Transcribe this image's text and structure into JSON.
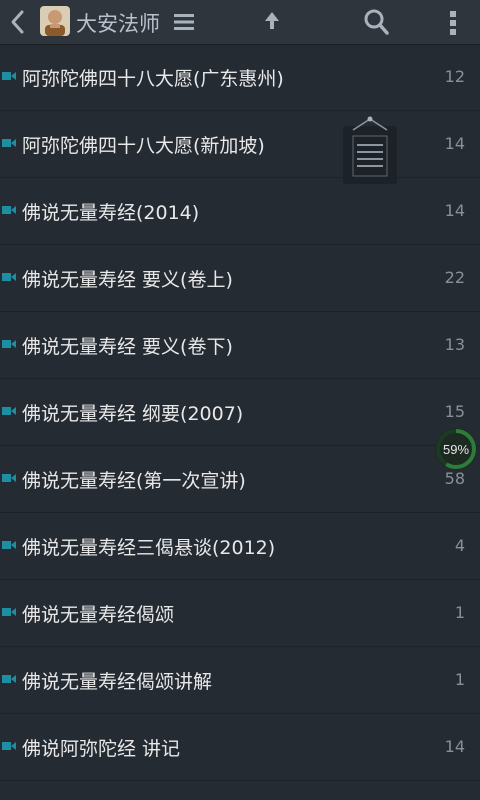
{
  "header": {
    "title": "大安法师",
    "back_icon": "chevron-left-icon",
    "menu_icon": "hamburger-menu-icon",
    "up_icon": "arrow-up-icon",
    "search_icon": "search-icon",
    "more_icon": "more-vertical-icon"
  },
  "colors": {
    "background": "#252b33",
    "topbar": "#2f353d",
    "video_icon": "#1e8fa0",
    "progress_ring": "#2d7d3a"
  },
  "items": [
    {
      "label": "阿弥陀佛四十八大愿(广东惠州)",
      "count": "12",
      "icon": "video-icon"
    },
    {
      "label": "阿弥陀佛四十八大愿(新加坡)",
      "count": "14",
      "icon": "video-icon"
    },
    {
      "label": "佛说无量寿经(2014)",
      "count": "14",
      "icon": "video-icon"
    },
    {
      "label": "佛说无量寿经 要义(卷上)",
      "count": "22",
      "icon": "video-icon"
    },
    {
      "label": "佛说无量寿经 要义(卷下)",
      "count": "13",
      "icon": "video-icon"
    },
    {
      "label": "佛说无量寿经 纲要(2007)",
      "count": "15",
      "icon": "video-icon"
    },
    {
      "label": "佛说无量寿经(第一次宣讲)",
      "count": "58",
      "icon": "video-icon"
    },
    {
      "label": "佛说无量寿经三偈悬谈(2012)",
      "count": "4",
      "icon": "video-icon"
    },
    {
      "label": "佛说无量寿经偈颂",
      "count": "1",
      "icon": "video-icon"
    },
    {
      "label": "佛说无量寿经偈颂讲解",
      "count": "1",
      "icon": "video-icon"
    },
    {
      "label": "佛说阿弥陀经 讲记",
      "count": "14",
      "icon": "video-icon"
    }
  ],
  "overlay": {
    "progress_text": "59%",
    "progress_value": 59,
    "note_icon": "notepad-icon"
  }
}
